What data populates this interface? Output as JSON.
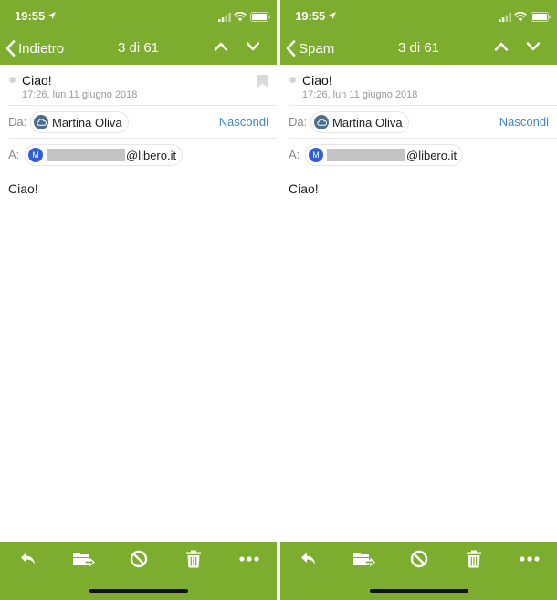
{
  "colors": {
    "accent": "#7cad2f",
    "link": "#3b87c9",
    "muted": "#999999"
  },
  "screens": [
    {
      "status": {
        "time": "19:55"
      },
      "nav": {
        "back_label": "Indietro",
        "counter": "3 di 61"
      },
      "message": {
        "subject": "Ciao!",
        "date": "17:26, lun 11 giugno 2018",
        "from_label": "Da:",
        "sender_name": "Martina Oliva",
        "hide_label": "Nascondi",
        "to_label": "A:",
        "recipient_initial": "M",
        "recipient_domain": "@libero.it",
        "body": "Ciao!"
      },
      "toolbar": [
        "reply-icon",
        "move-folder-icon",
        "spam-icon",
        "trash-icon",
        "more-icon"
      ]
    },
    {
      "status": {
        "time": "19:55"
      },
      "nav": {
        "back_label": "Spam",
        "counter": "3 di 61"
      },
      "message": {
        "subject": "Ciao!",
        "date": "17:26, lun 11 giugno 2018",
        "from_label": "Da:",
        "sender_name": "Martina Oliva",
        "hide_label": "Nascondi",
        "to_label": "A:",
        "recipient_initial": "M",
        "recipient_domain": "@libero.it",
        "body": "Ciao!"
      },
      "toolbar": [
        "reply-icon",
        "move-folder-icon",
        "spam-icon",
        "trash-icon",
        "more-icon"
      ]
    }
  ]
}
